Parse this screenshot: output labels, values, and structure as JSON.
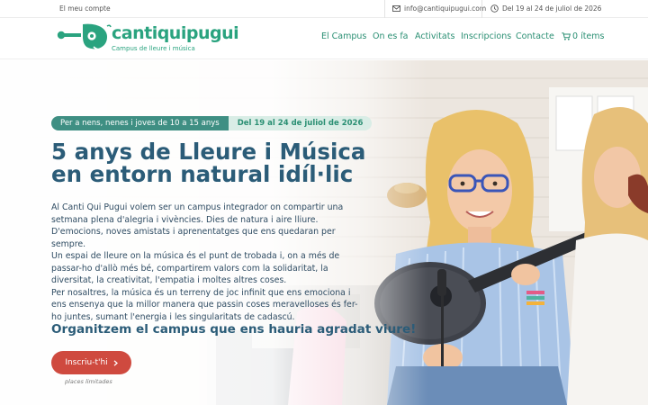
{
  "topbar": {
    "account": "El meu compte",
    "email": "info@cantiquipugui.com",
    "dates": "Del 19 al 24 de juliol de 2026",
    "icons": {
      "email": "mail-icon",
      "dates": "clock-icon"
    }
  },
  "brand": {
    "name": "cantiquipugui",
    "tagline": "Campus de lleure i música",
    "color": "#2aa37f"
  },
  "nav": {
    "items": [
      {
        "label": "El Campus"
      },
      {
        "label": "On es fa"
      },
      {
        "label": "Activitats"
      },
      {
        "label": "Inscripcions"
      },
      {
        "label": "Contacte"
      }
    ],
    "cart_label": "0 ítems",
    "cart_icon": "cart-icon"
  },
  "hero": {
    "badge_age": "Per a nens, nenes i joves de 10 a 15 anys",
    "badge_dates": "Del 19 al 24 de juliol de 2026",
    "title_line1": "5 anys de Lleure i Música",
    "title_line2": "en entorn natural idíl·lic",
    "paragraphs": [
      "Al Canti Qui Pugui volem ser un campus integrador on compartir una setmana plena d'alegria i vivències. Dies de natura i aire lliure. D'emocions, noves amistats i aprenentatges que ens quedaran per sempre.",
      "Un espai de lleure on la música és el punt de trobada i, on a més de passar-ho d'allò més bé, compartirem valors com la solidaritat, la diversitat, la creativitat, l'empatia i moltes altres coses.",
      "Per nosaltres, la música és un terreny de joc infinit que ens emociona i ens ensenya que la millor manera que passin coses meravelloses és fer-ho juntes, sumant l'energia i les singularitats de cadascú."
    ],
    "subheading": "Organitzem el campus que ens hauria agradat viure!",
    "cta_label": "Inscriu-t'hi",
    "cta_note": "places limitades",
    "colors": {
      "accent": "#3f8f83",
      "title": "#2b5c78",
      "cta": "#cf4a3f"
    }
  }
}
